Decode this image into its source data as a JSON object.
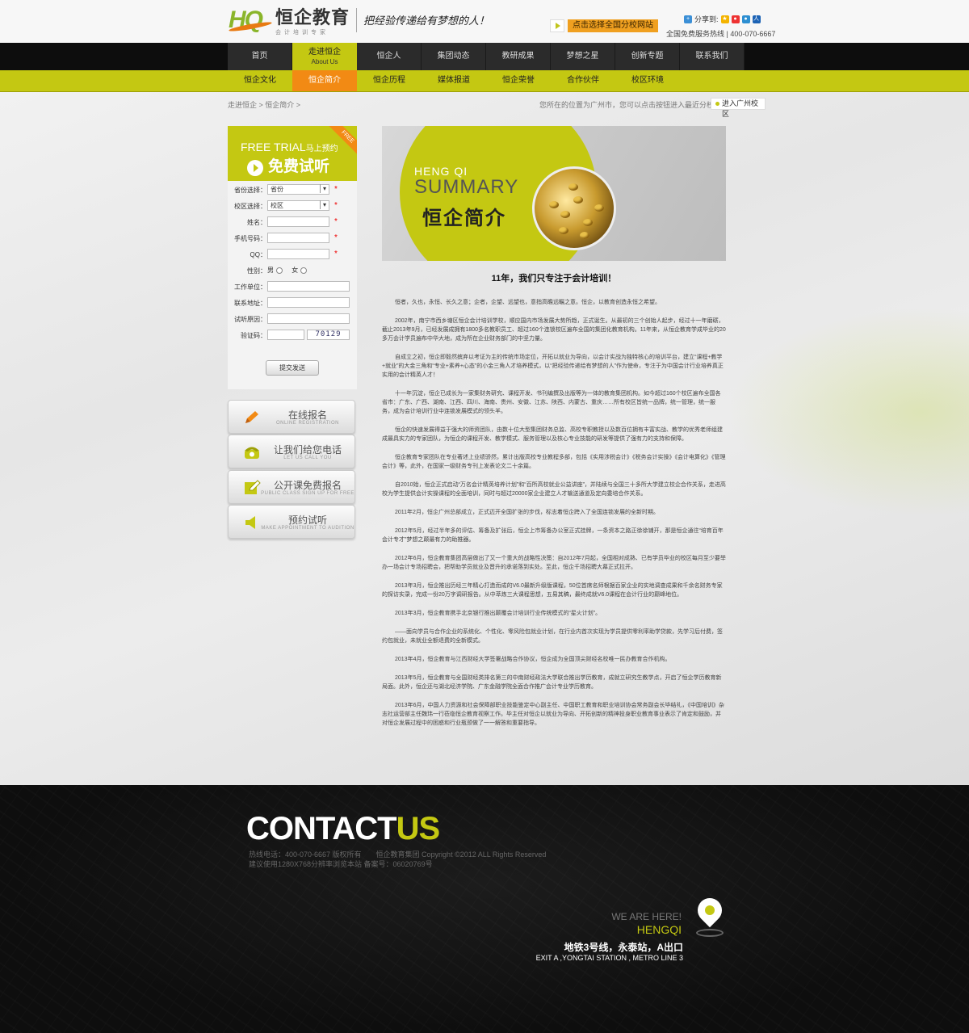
{
  "header": {
    "logo_mark": "HQ",
    "logo_cn": "恒企教育",
    "logo_sub": "会计培训专家",
    "slogan": "把经验传递给有梦想的人！",
    "select_school": "点击选择全国分校网站",
    "share_label": "分享到:",
    "hotline": "全国免费服务热线 | 400-070-6667"
  },
  "nav": {
    "items": [
      {
        "label": "首页"
      },
      {
        "label": "走进恒企",
        "en": "About Us"
      },
      {
        "label": "恒企人"
      },
      {
        "label": "集团动态"
      },
      {
        "label": "教研成果"
      },
      {
        "label": "梦想之星"
      },
      {
        "label": "创新专题"
      },
      {
        "label": "联系我们"
      }
    ]
  },
  "subnav": {
    "items": [
      "恒企文化",
      "恒企简介",
      "恒企历程",
      "媒体报道",
      "恒企荣誉",
      "合作伙伴",
      "校区环境"
    ]
  },
  "breadcrumb": "走进恒企 > 恒企简介 >",
  "location_hint": "您所在的位置为广州市，您可以点击按钮进入最近分校区",
  "enter_campus": "进入广州校区",
  "trial": {
    "ribbon": "FREE",
    "en": "FREE TRIAL",
    "en_cn": "马上预约",
    "cn": "免费试听",
    "province_label": "省份选择：",
    "province_value": "省份",
    "campus_label": "校区选择：",
    "campus_value": "校区",
    "name_label": "姓名：",
    "phone_label": "手机号码：",
    "qq_label": "QQ：",
    "gender_label": "性别：",
    "gender_male": "男",
    "gender_female": "女",
    "work_label": "工作单位：",
    "address_label": "联系地址：",
    "reason_label": "试听原因：",
    "captcha_label": "验证码：",
    "captcha_value": "70129",
    "submit": "提交发送"
  },
  "side_buttons": [
    {
      "cn": "在线报名",
      "en": "ONLINE REGISTRATION",
      "icon": "pencil-icon"
    },
    {
      "cn": "让我们给您电话",
      "en": "LET US CALL YOU",
      "icon": "phone-icon"
    },
    {
      "cn": "公开课免费报名",
      "en": "PUBLIC CLASS SIGN UP FOR FREE",
      "icon": "edit-icon"
    },
    {
      "cn": "预约试听",
      "en": "MAKE APPOINTMENT TO AUDITION",
      "icon": "speaker-icon"
    }
  ],
  "banner": {
    "en1": "HENG QI",
    "en2": "SUMMARY",
    "cn": "恒企简介"
  },
  "article": {
    "title": "11年，我们只专注于会计培训！",
    "paragraphs": [
      "恒者，久也，永恒、长久之意；企者，企望、远望也，意指高瞻远瞩之意。恒企，以教育创造永恒之希望。",
      "2002年，南宁市西乡塘区恒企会计培训学校，顺应国内市场发展大势所趋，正式诞生。从最初的三个创始人起步，经过十一年磨砺，截止2013年9月，已经发展成拥有1800多名教职员工、超过160个连锁校区遍布全国的集团化教育机构。11年来，从恒企教育学成毕业的20多万会计学员遍布中华大地，成为所在企业财务部门的中坚力量。",
      "自成立之初，恒企即毅然摈弃以考证为主的传统市场定位，开拓以就业为导向，以会计实战为独特核心的培训平台，建立“课程+教学+就业”的大金三角和“专业+素养+心态”的小金三角人才培养模式，以“把经验传递给有梦想的人”作为使命，专注于为中国会计行业培养真正实用的会计精英人才！",
      "十一年沉淀，恒企已成长为一家集财务研究、课程开发、书刊编撰及出版等为一体的教育集团机构。如今超过160个校区遍布全国各省市：广东、广西、湖南、江西、四川、海南、贵州、安徽、江苏、陕西、内蒙古、重庆……所有校区皆统一品牌，统一管理，统一服务，成为会计培训行业中连锁发展模式的领头羊。",
      "恒企的快速发展得益于强大的师资团队，由数十位大型集团财务总监、高校专职教授以及数百位拥有丰富实战、教学的优秀老师组建成最具实力的专家团队，为恒企的课程开发、教学模式、服务管理以及核心专业技能的研发等提供了强有力的支持和保障。",
      "恒企教育专家团队在专业著述上业绩骄然，累计出版高校专业教程多部，包括《实用涉税会计》《税务会计实操》《会计电算化》《管理会计》等，此外，在国家一级财务专刊上发表论文二十余篇。",
      "自2010始，恒企正式启动“万名会计精英培养计划”和“百所高校就业公益讲座”，并陆续与全国三十多所大学建立校企合作关系，走进高校为学生提供会计实操课程的全面培训，同时与超过20000家企业建立人才输送通道及定向委培合作关系。",
      "2011年2月，恒企广州总部成立，正式迈开全国扩张的步伐，标志着恒企跨入了全国连锁发展的全新时期。",
      "2012年5月，经过半年多的评估、筹备及扩张后，恒企上市筹备办公室正式挂牌，一条资本之路正徐徐铺开，那是恒企通往“培育百年会计专才”梦想之颠最有力的助推器。",
      "2012年6月，恒企教育集团高层做出了又一个重大的战略性决策：自2012年7月起，全国相对成熟、已有学员毕业的校区每月至少要举办一场会计专场招聘会，把帮助学员就业及晋升的承诺落到实处。至此，恒企千场招聘大幕正式拉开。",
      "2013年3月，恒企推出历经三年精心打造而成的V6.0最新升级版课程，50位首席名师根据百家企业的实地调查成果和千余名财务专家的探访实录，完成一份20万字调研报告。从中萃炼三大课程思想，五易其稿，最终成就V6.0课程在会计行业的巅峰地位。",
      "2013年3月，恒企教育携手北京银行推出颠覆会计培训行业传统模式的“星火计划”。",
      "——面向学员与合作企业的系统化、个性化、零风险包就业计划，在行业内首次实现为学员提供零利率助学贷款，先学习后付费，签约包就业，未就业全额退费的全新模式。",
      "2013年4月，恒企教育与江西财经大学签署战略合作协议，恒企成为全国顶尖财经名校唯一民办教育合作机构。",
      "2013年5月，恒企教育与全国财经类排名第三的中南财经政法大学联合推出学历教育，成就立研究生教学点，开启了恒企学历教育新局面。此外，恒企还与湖北经济学院、广东金融学院全面合作推广会计专业学历教育。",
      "2013年6月，中国人力资源和社会保障部职业技能鉴定中心副主任、中国职工教育和职业培训协会常务副会长毕结礼，《中国培训》杂志社运营部主任魏玮一行莅临恒企教育视察工作。毕主任对恒企以就业为导向、开拓创新的精神投身职业教育事业表示了肯定和鼓励，并对恒企发展过程中的困惑和行业瓶颈做了一一解答和重要指导。"
    ]
  },
  "footer": {
    "contact_a": "CONTACT",
    "contact_b": "US",
    "copyright_1": "热线电话：400-070-6667 版权所有　　恒企教育集团 Copyright ©2012 ALL Rights Reserved",
    "copyright_2": "建议使用1280X768分辨率浏览本站 备案号：06020769号",
    "we_are_here": "WE ARE HERE!",
    "hengqi": "HENGQI",
    "metro_cn": "地铁3号线，永泰站，A出口",
    "metro_en": "EXIT A ,YONGTAI STATION , METRO LINE 3"
  },
  "colors": {
    "accent": "#c4c812",
    "orange": "#f28a14",
    "nav_bg": "#0d0d0d",
    "footer_bg": "#111111"
  }
}
